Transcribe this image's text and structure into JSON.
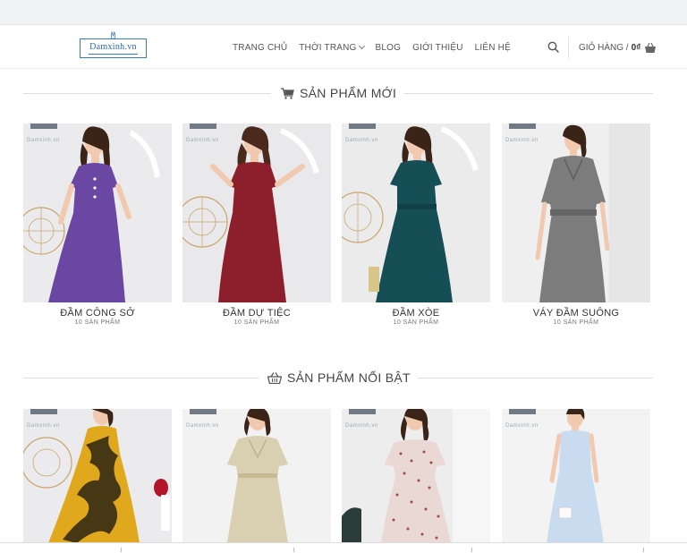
{
  "header": {
    "logo_text": "Damxinh.vn",
    "nav": [
      {
        "label": "TRANG CHỦ"
      },
      {
        "label": "THỜI TRANG",
        "has_dropdown": true
      },
      {
        "label": "BLOG"
      },
      {
        "label": "GIỚI THIỆU"
      },
      {
        "label": "LIÊN HỆ"
      }
    ],
    "cart_label": "GIỎ HÀNG /",
    "cart_total": "0₫"
  },
  "sections": {
    "new_products": {
      "title": "SẢN PHẨM MỚI",
      "icon": "shopping-cart-icon"
    },
    "featured_products": {
      "title": "SẢN PHẨM NỔI BẬT",
      "icon": "shopping-basket-icon"
    }
  },
  "categories": [
    {
      "name": "ĐẦM CÔNG SỞ",
      "count": "10 SẢN PHẨM",
      "dress_color": "#6a47a3"
    },
    {
      "name": "ĐẦM DỰ TIỆC",
      "count": "10 SẢN PHẨM",
      "dress_color": "#8c1f2b"
    },
    {
      "name": "ĐẦM XÒE",
      "count": "10 SẢN PHẨM",
      "dress_color": "#154e55"
    },
    {
      "name": "VÁY ĐẦM SUÔNG",
      "count": "10 SẢN PHẨM",
      "dress_color": "#7c7c7c"
    }
  ],
  "featured": [
    {
      "dress_color": "#e0a91d",
      "pattern": "floral-yellow-black"
    },
    {
      "dress_color": "#d8d0b0",
      "pattern": "checked-beige"
    },
    {
      "dress_color": "#ead8d4",
      "pattern": "floral-pink"
    },
    {
      "dress_color": "#c9dcef",
      "pattern": "solid-light-blue"
    }
  ],
  "watermark": "Damxinh.vn",
  "colors": {
    "accent_blue": "#3a78b8",
    "text_dark": "#333333"
  }
}
